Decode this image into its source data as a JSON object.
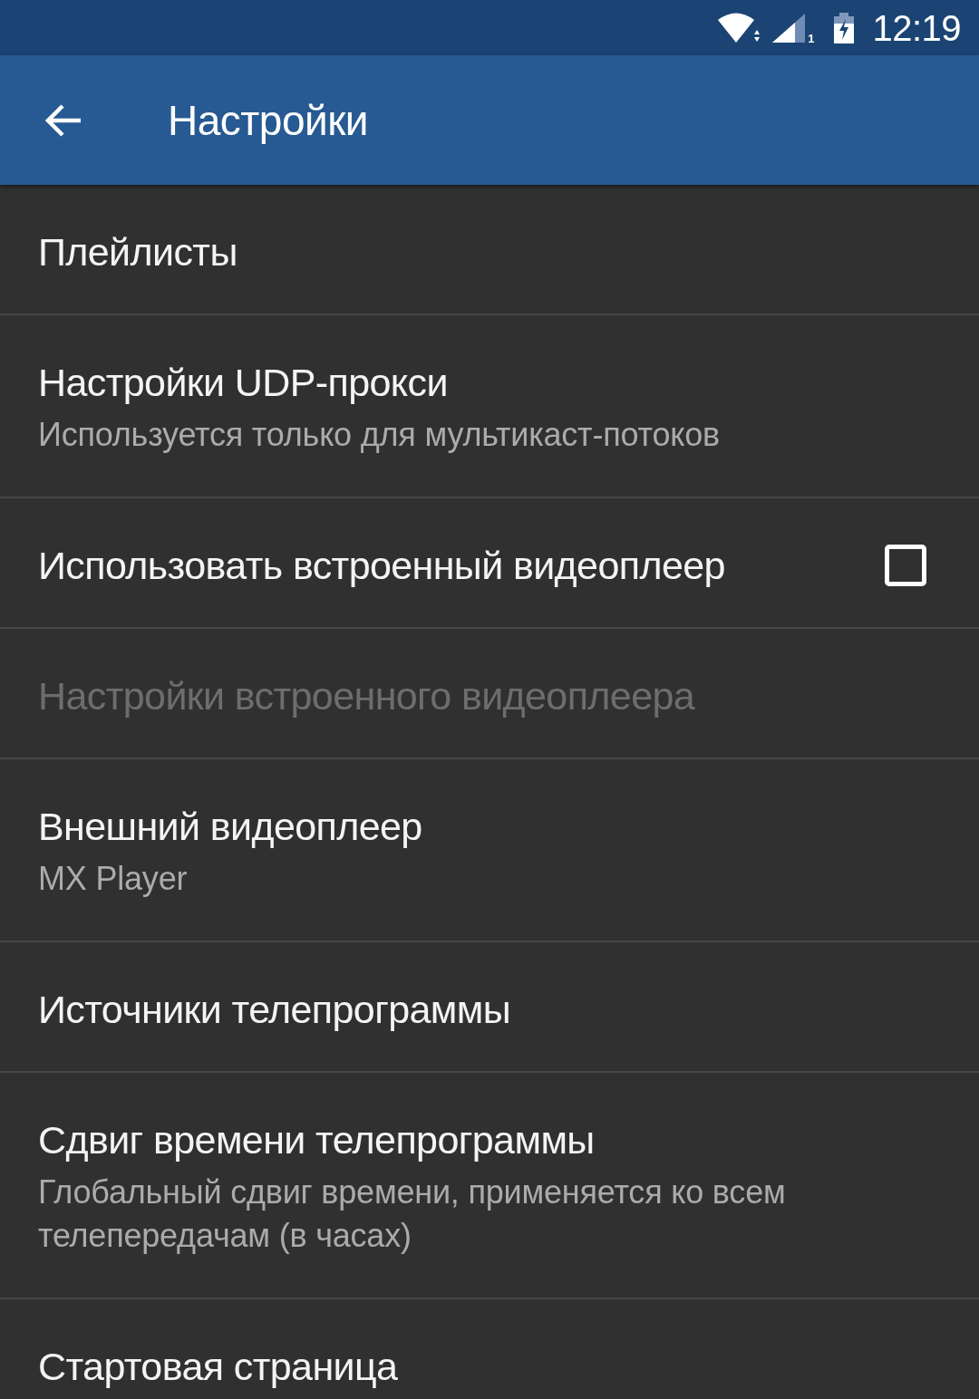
{
  "status_bar": {
    "sim_label": "1",
    "time": "12:19"
  },
  "app_bar": {
    "title": "Настройки"
  },
  "settings": [
    {
      "kind": "preference",
      "title": "Плейлисты",
      "disabled": false
    },
    {
      "kind": "preference",
      "title": "Настройки UDP-прокси",
      "summary": "Используется только для мультикаст-потоков",
      "disabled": false
    },
    {
      "kind": "checkbox",
      "title": "Использовать встроенный видеоплеер",
      "checked": false,
      "disabled": false
    },
    {
      "kind": "preference",
      "title": "Настройки встроенного видеоплеера",
      "disabled": true
    },
    {
      "kind": "preference",
      "title": "Внешний видеоплеер",
      "summary": "MX Player",
      "disabled": false
    },
    {
      "kind": "preference",
      "title": "Источники телепрограммы",
      "disabled": false
    },
    {
      "kind": "preference",
      "title": "Сдвиг времени телепрограммы",
      "summary": "Глобальный сдвиг времени, применяется ко всем телепередачам (в часах)",
      "disabled": false
    },
    {
      "kind": "preference",
      "title": "Стартовая страница",
      "disabled": false
    }
  ]
}
